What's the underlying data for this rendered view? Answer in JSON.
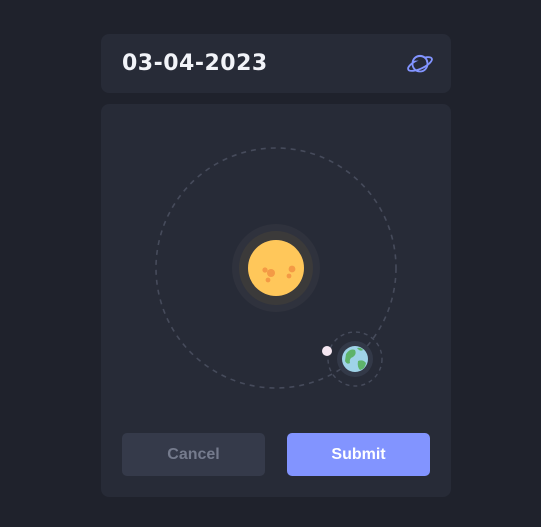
{
  "date": {
    "value": "03-04-2023",
    "icon": "planet-icon"
  },
  "buttons": {
    "cancel_label": "Cancel",
    "submit_label": "Submit"
  },
  "colors": {
    "background": "#1f222c",
    "card": "#272b37",
    "accent": "#8294ff",
    "sun": "#ffc75a",
    "earth_water": "#9fd3e8",
    "earth_land": "#5eb36a"
  }
}
